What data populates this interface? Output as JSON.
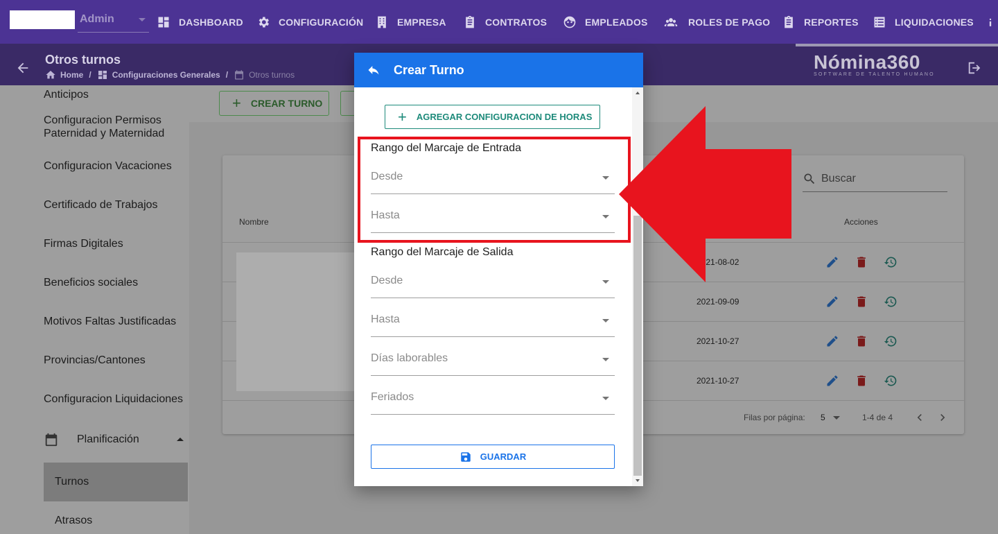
{
  "topbar": {
    "user_label": "Admin",
    "nav": [
      {
        "label": "DASHBOARD",
        "icon": "dashboard-icon"
      },
      {
        "label": "CONFIGURACIÓN",
        "icon": "gear-icon"
      },
      {
        "label": "EMPRESA",
        "icon": "building-icon"
      },
      {
        "label": "CONTRATOS",
        "icon": "clipboard-icon"
      },
      {
        "label": "EMPLEADOS",
        "icon": "face-icon"
      },
      {
        "label": "ROLES DE PAGO",
        "icon": "people-icon"
      },
      {
        "label": "REPORTES",
        "icon": "clipboard-icon"
      },
      {
        "label": "LIQUIDACIONES",
        "icon": "list-icon"
      }
    ]
  },
  "subheader": {
    "page_title": "Otros turnos",
    "breadcrumb": [
      "Home",
      "Configuraciones Generales",
      "Otros turnos"
    ],
    "brand_name": "Nómina360",
    "brand_tagline": "SOFTWARE DE TALENTO HUMANO"
  },
  "sidebar": {
    "items": [
      "Anticipos",
      "Configuracion Permisos Paternidad y Maternidad",
      "Configuracion Vacaciones",
      "Certificado de Trabajos",
      "Firmas Digitales",
      "Beneficios sociales",
      "Motivos Faltas Justificadas",
      "Provincias/Cantones",
      "Configuracion Liquidaciones"
    ],
    "group_label": "Planificación",
    "sub_items": [
      "Turnos",
      "Atrasos"
    ]
  },
  "main": {
    "create_button": "CREAR TURNO",
    "search_placeholder": "Buscar",
    "table": {
      "headers": {
        "name": "Nombre",
        "actions": "Acciones"
      },
      "dates": [
        "2021-08-02",
        "2021-09-09",
        "2021-10-27",
        "2021-10-27"
      ]
    },
    "footer": {
      "rows_per_page_label": "Filas por página:",
      "rows_per_page": "5",
      "range": "1-4 de 4"
    }
  },
  "modal": {
    "title": "Crear Turno",
    "add_hours_button": "AGREGAR CONFIGURACION DE HORAS",
    "entry_section": {
      "title": "Rango del Marcaje de Entrada",
      "from_placeholder": "Desde",
      "to_placeholder": "Hasta"
    },
    "exit_section": {
      "title": "Rango del Marcaje de Salida",
      "from_placeholder": "Desde",
      "to_placeholder": "Hasta"
    },
    "workdays_placeholder": "Días laborables",
    "holidays_placeholder": "Feriados",
    "save_button": "GUARDAR"
  },
  "colors": {
    "nav_bg": "#4c3394",
    "modal_header": "#1a73e8",
    "annotation_red": "#e8141e",
    "edit_icon": "#1565c0",
    "delete_icon": "#b71c1c",
    "history_icon": "#00695c"
  }
}
